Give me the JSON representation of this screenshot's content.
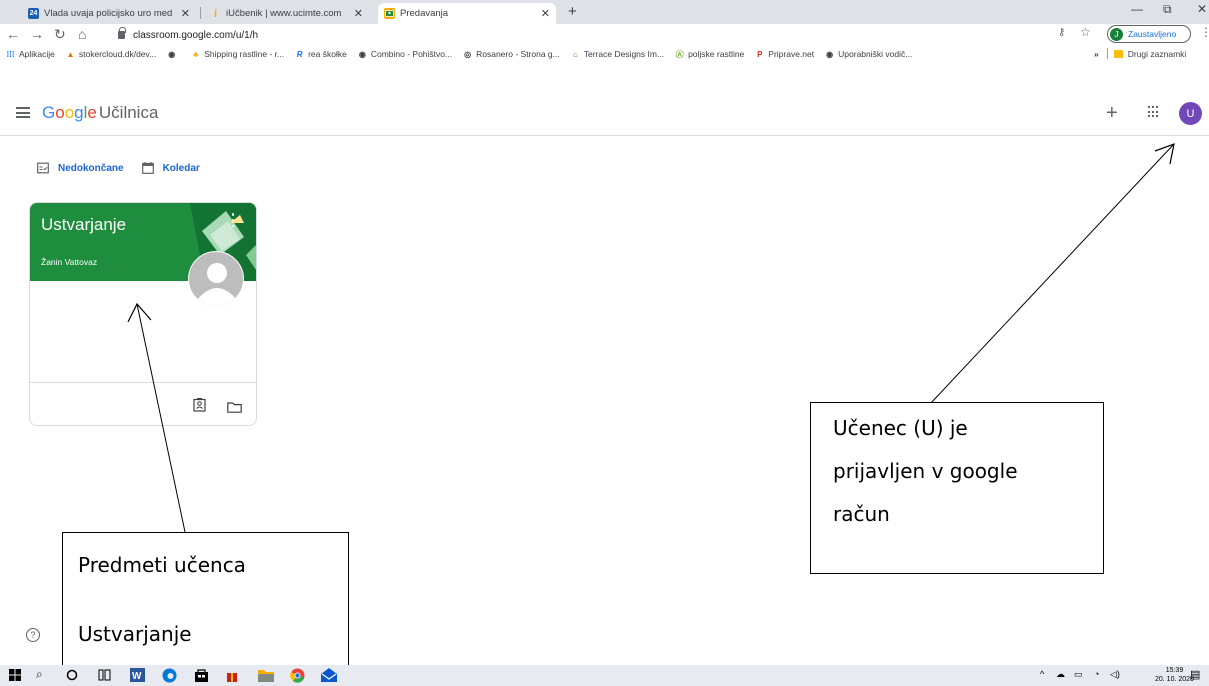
{
  "browser": {
    "tabs": [
      {
        "label": "Vlada uvaja policijsko uro med 2",
        "favicon": "24",
        "active": false
      },
      {
        "label": "iUčbenik | www.ucimte.com",
        "favicon": "i",
        "active": false
      },
      {
        "label": "Predavanja",
        "favicon": "classroom",
        "active": true
      }
    ],
    "url": "classroom.google.com/u/1/h",
    "profile_initial": "J",
    "profile_status": "Zaustavljeno",
    "bookmarks": [
      "Aplikacije",
      "stokercloud.dk/dev...",
      "Shipping rastline - r...",
      "rea škołke",
      "Combino - Pohištvo...",
      "Rosanero - Strona g...",
      "Terrace Designs Im...",
      "poljske rastline",
      "Priprave.net",
      "Uporabniški vodič..."
    ],
    "bookmarks_overflow": "»",
    "other_bookmarks": "Drugi zaznamki"
  },
  "app": {
    "brand_google": "Google",
    "brand_product": "Učilnica",
    "user_initial": "U"
  },
  "subnav": {
    "todo": "Nedokončane",
    "calendar": "Koledar"
  },
  "class_card": {
    "title": "Ustvarjanje",
    "teacher": "Žanin Vattovaz"
  },
  "help_label": "?",
  "annotations": {
    "left_line1": "Predmeti  učenca",
    "left_line2": "Ustvarjanje",
    "right_line1": "Učenec (U) je",
    "right_line2": "prijavljen v google",
    "right_line3": "račun"
  },
  "taskbar": {
    "time": "15:39",
    "date": "20. 10. 2020"
  },
  "colors": {
    "card_banner": "#1e8e3e",
    "user_avatar": "#7248b9",
    "accent_blue": "#1967d2"
  }
}
